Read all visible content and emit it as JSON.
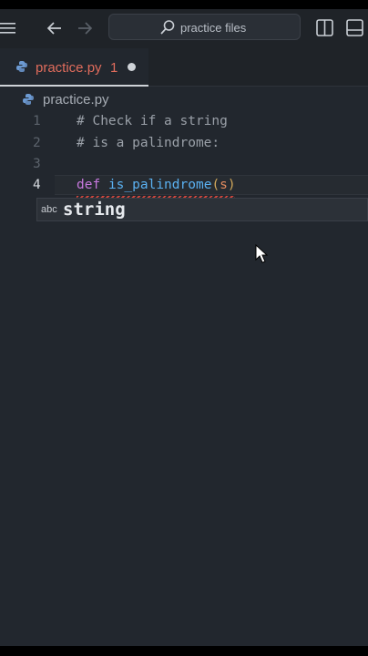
{
  "titlebar": {
    "search_text": "practice files"
  },
  "tab": {
    "label": "practice.py",
    "problem_count": "1"
  },
  "breadcrumb": {
    "file": "practice.py"
  },
  "code": {
    "line_numbers": [
      "1",
      "2",
      "3",
      "4"
    ],
    "line1": "# Check if a string",
    "line2": "# is a palindrome:",
    "line4": {
      "keyword": "def",
      "function": "is_palindrome",
      "open_paren": "(",
      "param": "s",
      "close_paren": ")"
    }
  },
  "suggestion": {
    "kind": "abc",
    "text": "string"
  },
  "icons": [
    "menu-icon",
    "back-arrow-icon",
    "forward-arrow-icon",
    "search-icon",
    "split-layout-icon",
    "panel-layout-icon",
    "python-icon",
    "mouse-cursor-icon"
  ]
}
